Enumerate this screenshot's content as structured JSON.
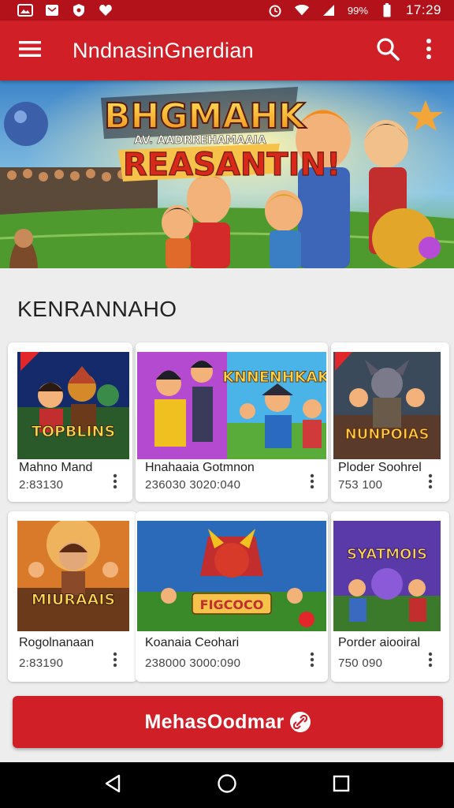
{
  "status_bar": {
    "battery": "99%",
    "time": "17:29",
    "notification_icons": [
      "gallery-icon",
      "message-icon",
      "shield-icon",
      "heart-icon"
    ]
  },
  "app_bar": {
    "title": "NndnasinGnerdian",
    "menu_icon": "hamburger-menu-icon",
    "search_icon": "search-icon",
    "more_icon": "more-vert-icon"
  },
  "hero": {
    "line1": "BHGMAHK",
    "line2": "AV. AADRREHAMAAIA",
    "line3": "REASANTIN!"
  },
  "section": {
    "title": "KENRANNAHO"
  },
  "cards": [
    {
      "thumb_title": "TOPBLINS",
      "title": "Mahno Mand",
      "meta": "2:83130"
    },
    {
      "thumb_title": "KNNENHKAK",
      "title": "Hnahaaia Gotmnon",
      "meta": "236030  3020:040"
    },
    {
      "thumb_title": "NUNPOIAS",
      "title": "Ploder Soohrel",
      "meta": "753 100"
    },
    {
      "thumb_title": "MIURAAIS",
      "title": "Rogolnanaan",
      "meta": "2:83190"
    },
    {
      "thumb_title": "FIGCOCO",
      "title": "Koanaia Ceohari",
      "meta": "238000  3000:090"
    },
    {
      "thumb_title": "SYATMOIS",
      "title": "Porder aiooiral",
      "meta": "750 090"
    }
  ],
  "cta": {
    "label": "MehasOodmar",
    "icon": "link-icon"
  },
  "nav_bar": {
    "back_icon": "back-triangle-icon",
    "home_icon": "home-circle-icon",
    "recents_icon": "recents-square-icon"
  },
  "colors": {
    "primary": "#d11f27",
    "status_bar": "#b3121b",
    "background": "#ededed"
  }
}
